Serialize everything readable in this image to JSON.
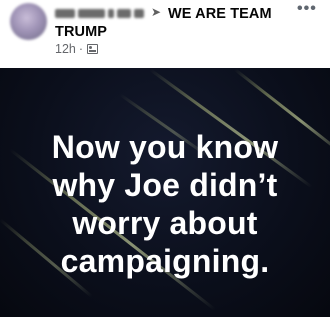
{
  "post": {
    "group_name": "WE ARE TEAM TRUMP",
    "timestamp": "12h",
    "separator": "·",
    "privacy_icon": "album-icon",
    "more_icon": "more-horizontal-icon",
    "more_label": "•••"
  },
  "image": {
    "lines": [
      "Now you know",
      "why Joe didn’t",
      "worry about",
      "campaigning."
    ],
    "background_color": "#0b0f1c",
    "text_color": "#ffffff"
  }
}
